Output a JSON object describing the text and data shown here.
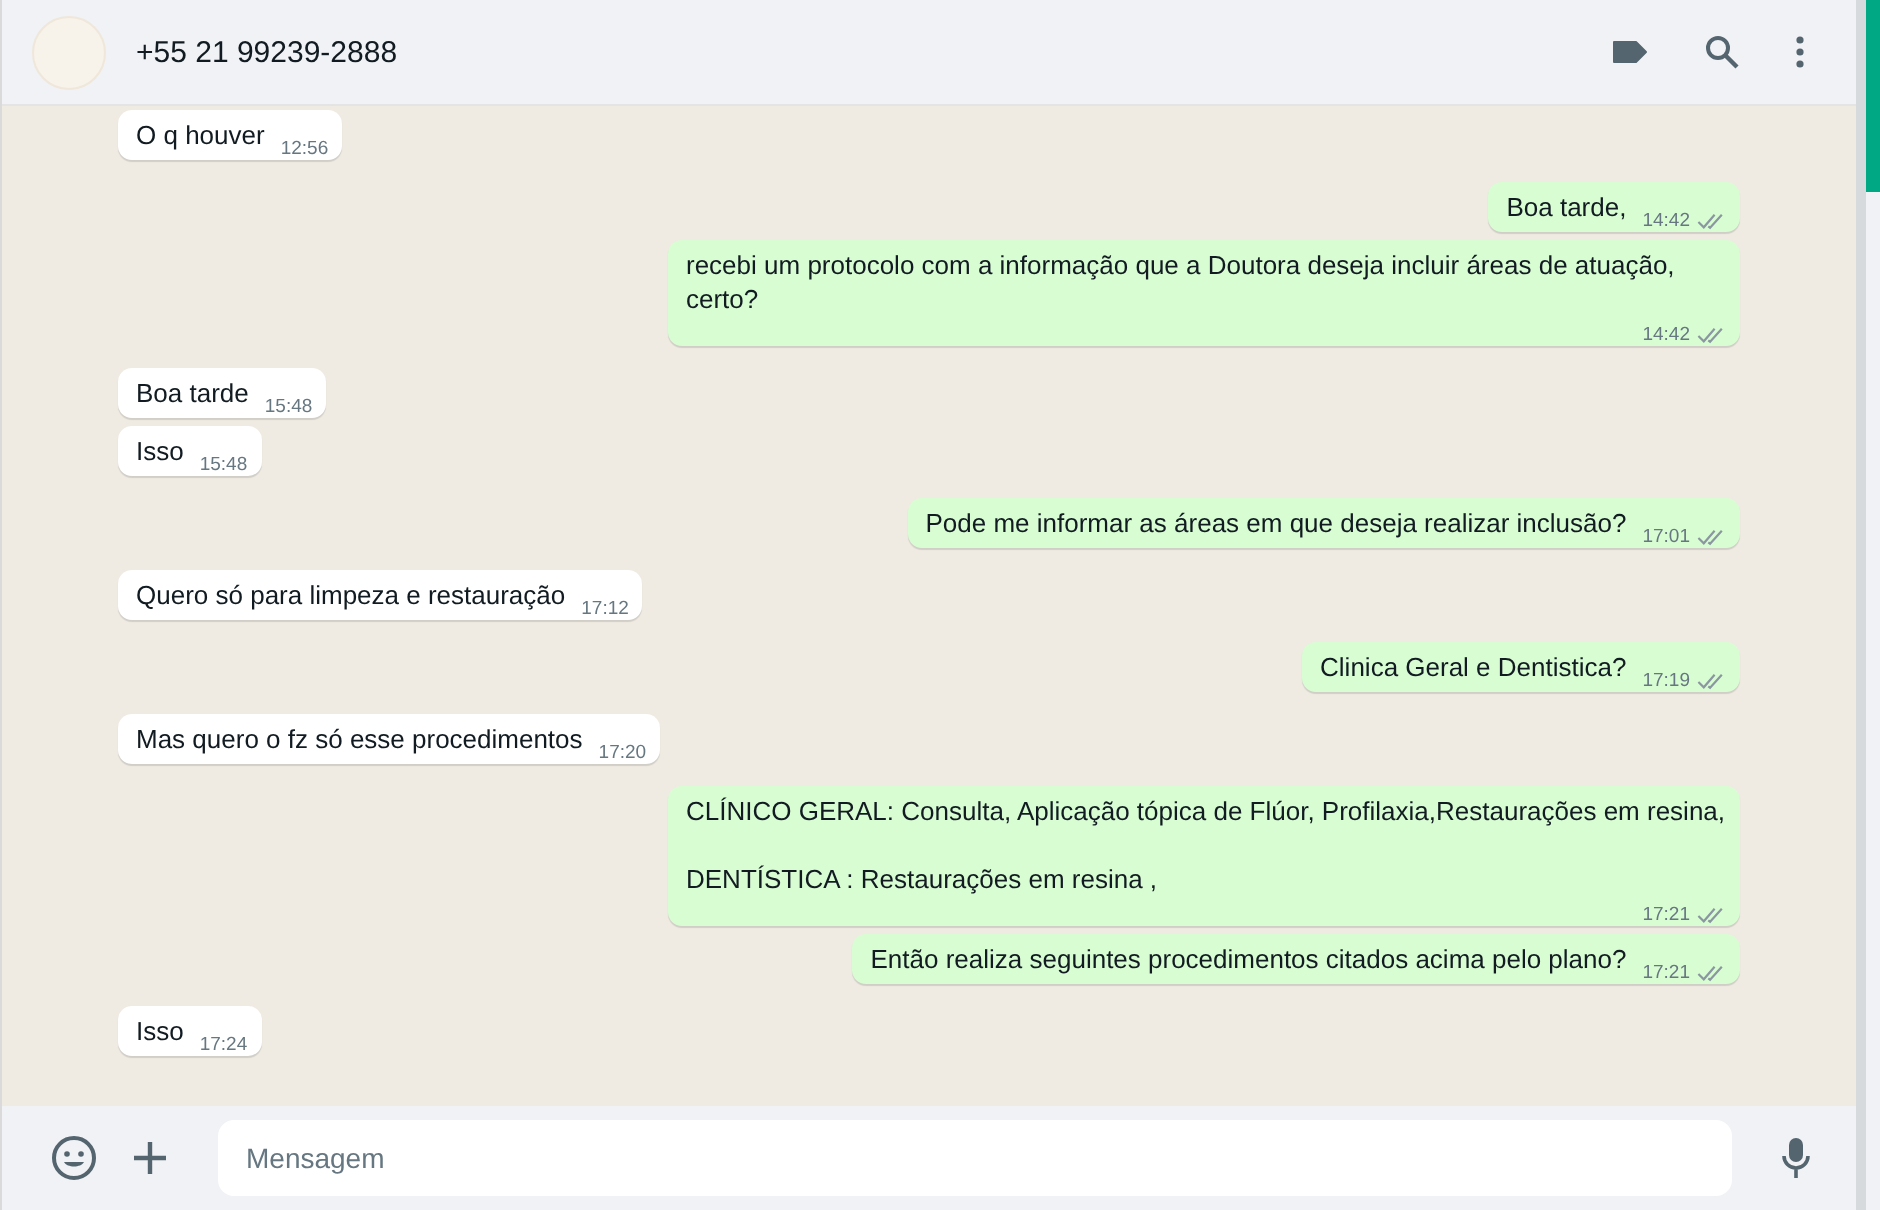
{
  "header": {
    "contact": "+55 21 99239-2888"
  },
  "messages": [
    {
      "outgoing": false,
      "text": "O q houver",
      "time": "12:56"
    },
    {
      "outgoing": true,
      "text": "Boa tarde,",
      "time": "14:42"
    },
    {
      "outgoing": true,
      "text": "recebi um protocolo com a informação que a Doutora deseja incluir áreas de atuação, certo?",
      "time": "14:42"
    },
    {
      "outgoing": false,
      "text": "Boa tarde",
      "time": "15:48"
    },
    {
      "outgoing": false,
      "text": "Isso",
      "time": "15:48"
    },
    {
      "outgoing": true,
      "text": "Pode me informar as áreas em que deseja realizar inclusão?",
      "time": "17:01"
    },
    {
      "outgoing": false,
      "text": "Quero só para limpeza e restauração",
      "time": "17:12"
    },
    {
      "outgoing": true,
      "text": "Clinica Geral e Dentistica?",
      "time": "17:19"
    },
    {
      "outgoing": false,
      "text": "Mas quero o fz só esse procedimentos",
      "time": "17:20"
    },
    {
      "outgoing": true,
      "text": "CLÍNICO GERAL: Consulta, Aplicação tópica de Flúor, Profilaxia,Restaurações em resina,\n\nDENTÍSTICA : Restaurações em resina ,",
      "time": "17:21"
    },
    {
      "outgoing": true,
      "text": "Então realiza seguintes procedimentos citados acima pelo plano?",
      "time": "17:21"
    },
    {
      "outgoing": false,
      "text": "Isso",
      "time": "17:24"
    }
  ],
  "composer": {
    "placeholder": "Mensagem"
  }
}
